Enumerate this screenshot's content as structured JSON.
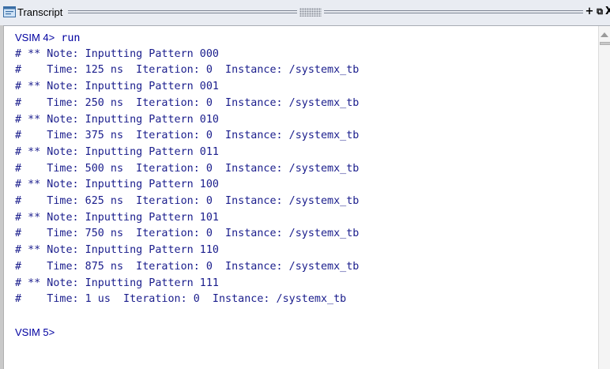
{
  "window": {
    "title": "Transcript",
    "icon": "transcript-icon",
    "buttons": [
      "+",
      "⧉",
      "X"
    ]
  },
  "transcript": {
    "lines": [
      {
        "type": "prompt",
        "prompt": "VSIM 4>",
        "command": " run"
      },
      {
        "type": "text",
        "text": "# ** Note: Inputting Pattern 000"
      },
      {
        "type": "text",
        "text": "#    Time: 125 ns  Iteration: 0  Instance: /systemx_tb"
      },
      {
        "type": "text",
        "text": "# ** Note: Inputting Pattern 001"
      },
      {
        "type": "text",
        "text": "#    Time: 250 ns  Iteration: 0  Instance: /systemx_tb"
      },
      {
        "type": "text",
        "text": "# ** Note: Inputting Pattern 010"
      },
      {
        "type": "text",
        "text": "#    Time: 375 ns  Iteration: 0  Instance: /systemx_tb"
      },
      {
        "type": "text",
        "text": "# ** Note: Inputting Pattern 011"
      },
      {
        "type": "text",
        "text": "#    Time: 500 ns  Iteration: 0  Instance: /systemx_tb"
      },
      {
        "type": "text",
        "text": "# ** Note: Inputting Pattern 100"
      },
      {
        "type": "text",
        "text": "#    Time: 625 ns  Iteration: 0  Instance: /systemx_tb"
      },
      {
        "type": "text",
        "text": "# ** Note: Inputting Pattern 101"
      },
      {
        "type": "text",
        "text": "#    Time: 750 ns  Iteration: 0  Instance: /systemx_tb"
      },
      {
        "type": "text",
        "text": "# ** Note: Inputting Pattern 110"
      },
      {
        "type": "text",
        "text": "#    Time: 875 ns  Iteration: 0  Instance: /systemx_tb"
      },
      {
        "type": "text",
        "text": "# ** Note: Inputting Pattern 111"
      },
      {
        "type": "text",
        "text": "#    Time: 1 us  Iteration: 0  Instance: /systemx_tb"
      },
      {
        "type": "blank",
        "text": ""
      },
      {
        "type": "prompt",
        "prompt": "VSIM 5>",
        "command": ""
      }
    ]
  },
  "colors": {
    "text": "#1a1d8c",
    "prompt": "#0000a0",
    "background": "#ffffff"
  }
}
